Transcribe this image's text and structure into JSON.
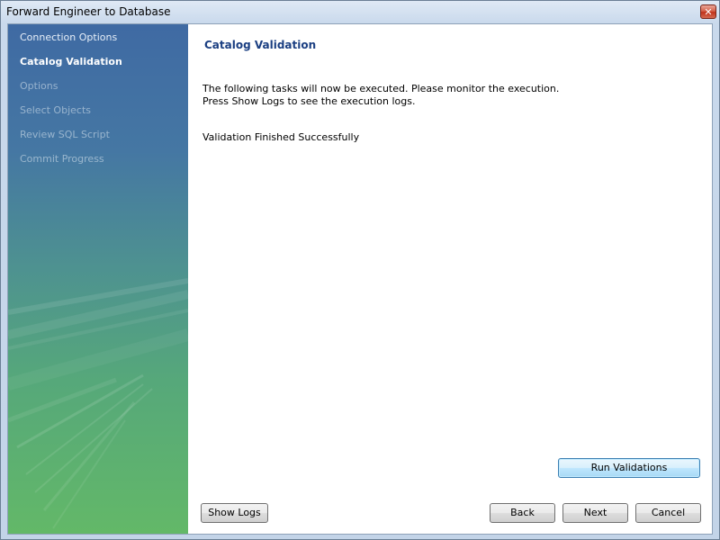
{
  "window": {
    "title": "Forward Engineer to Database",
    "close_glyph": "✕"
  },
  "sidebar": {
    "items": [
      {
        "label": "Connection Options",
        "state": "done"
      },
      {
        "label": "Catalog Validation",
        "state": "active"
      },
      {
        "label": "Options",
        "state": "pending"
      },
      {
        "label": "Select Objects",
        "state": "pending"
      },
      {
        "label": "Review SQL Script",
        "state": "pending"
      },
      {
        "label": "Commit Progress",
        "state": "pending"
      }
    ]
  },
  "main": {
    "title": "Catalog Validation",
    "description_line1": "The following tasks will now be executed. Please monitor the execution.",
    "description_line2": "Press Show Logs to see the execution logs.",
    "status": "Validation Finished Successfully"
  },
  "buttons": {
    "run_validations": "Run Validations",
    "show_logs": "Show Logs",
    "back": "Back",
    "next": "Next",
    "cancel": "Cancel"
  },
  "colors": {
    "accent_title": "#1b3f82",
    "sidebar_top": "#3f6aa3",
    "sidebar_bottom": "#63b868"
  }
}
